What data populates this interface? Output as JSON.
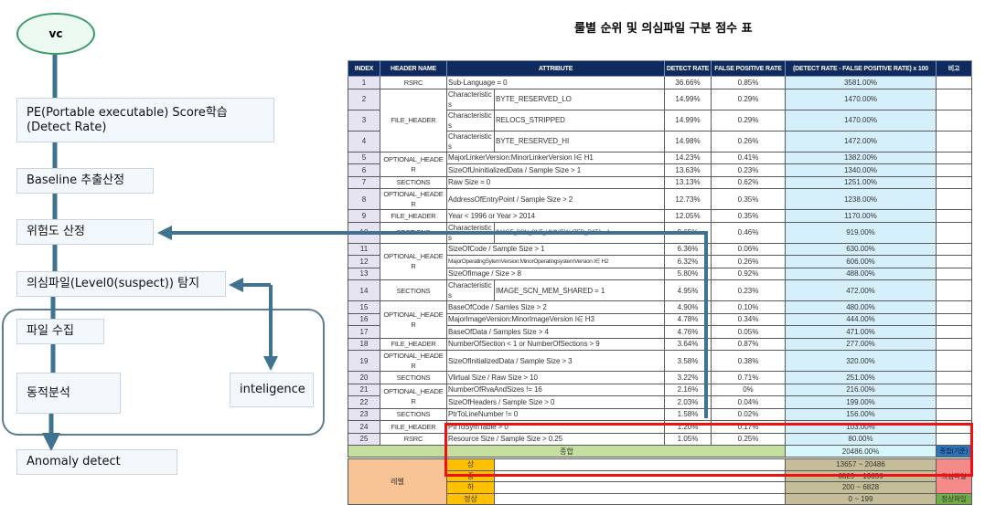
{
  "flow": {
    "start": "vc",
    "steps": [
      "PE(Portable executable) Score학습",
      "(Detect Rate)",
      "Baseline 추출산정",
      "위험도 산정",
      "의심파일(Level0(suspect)) 탐지",
      "파일 수집",
      "동적분석",
      "inteligence",
      "Anomaly detect"
    ]
  },
  "table": {
    "title": "룰별 순위 및 의심파일 구분 점수 표",
    "headers": [
      "INDEX",
      "HEADER NAME",
      "ATTRIBUTE",
      "DETECT RATE",
      "FALSE POSITIVE RATE",
      "(DETECT RATE - FALSE POSITIVE RATE) x 100",
      "비고"
    ],
    "groups": [
      {
        "name": "RSRC",
        "span": 1
      },
      {
        "name": "FILE_HEADER",
        "span": 3
      },
      {
        "name": "OPTIONAL_HEADER",
        "span": 2
      },
      {
        "name": "SECTIONS",
        "span": 1
      },
      {
        "name": "OPTIONAL_HEADER",
        "span": 1
      },
      {
        "name": "FILE_HEADER",
        "span": 1
      },
      {
        "name": "SECTIONS",
        "span": 1
      },
      {
        "name": "OPTIONAL_HEADER",
        "span": 3
      },
      {
        "name": "SECTIONS",
        "span": 1
      },
      {
        "name": "OPTIONAL_HEADER",
        "span": 3
      },
      {
        "name": "FILE_HEADER",
        "span": 1
      },
      {
        "name": "OPTIONAL_HEADER",
        "span": 1
      },
      {
        "name": "SECTIONS",
        "span": 1
      },
      {
        "name": "OPTIONAL_HEADER",
        "span": 2
      },
      {
        "name": "SECTIONS",
        "span": 1
      },
      {
        "name": "FILE_HEADER",
        "span": 1
      },
      {
        "name": "RSRC",
        "span": 1
      }
    ],
    "rows": [
      {
        "index": "1",
        "attr": [
          "Sub-Language = 0"
        ],
        "dr": "36.66%",
        "fpr": "0.85%",
        "score": "3581.00%"
      },
      {
        "index": "2",
        "attr": [
          "Characteristics",
          "BYTE_RESERVED_LO"
        ],
        "dr": "14.99%",
        "fpr": "0.29%",
        "score": "1470.00%"
      },
      {
        "index": "3",
        "attr": [
          "Characteristics",
          "RELOCS_STRIPPED"
        ],
        "dr": "14.99%",
        "fpr": "0.29%",
        "score": "1470.00%"
      },
      {
        "index": "4",
        "attr": [
          "Characteristics",
          "BYTE_RESERVED_HI"
        ],
        "dr": "14.98%",
        "fpr": "0.26%",
        "score": "1472.00%"
      },
      {
        "index": "5",
        "attr": [
          "MajorLinkerVersion:MinorLinkerVersion I∈ H1"
        ],
        "dr": "14.23%",
        "fpr": "0.41%",
        "score": "1382.00%"
      },
      {
        "index": "6",
        "attr": [
          "SizeOfUninitializedData / Sample Size > 1"
        ],
        "dr": "13.63%",
        "fpr": "0.23%",
        "score": "1340.00%"
      },
      {
        "index": "7",
        "attr": [
          "Raw Size = 0"
        ],
        "dr": "13.13%",
        "fpr": "0.62%",
        "score": "1251.00%"
      },
      {
        "index": "8",
        "attr": [
          "AddressOfEntryPoint / Sample Size > 2"
        ],
        "dr": "12.73%",
        "fpr": "0.35%",
        "score": "1238.00%"
      },
      {
        "index": "9",
        "attr": [
          "Year < 1996 or Year > 2014"
        ],
        "dr": "12.05%",
        "fpr": "0.35%",
        "score": "1170.00%"
      },
      {
        "index": "10",
        "attr": [
          "Characteristics",
          "IMAGE_SCN_CNT_UNINITIALIZED_DATA = 1"
        ],
        "dr": "9.65%",
        "fpr": "0.46%",
        "score": "919.00%"
      },
      {
        "index": "11",
        "attr": [
          "SizeOfCode / Sample Size > 1"
        ],
        "dr": "6.36%",
        "fpr": "0.06%",
        "score": "630.00%"
      },
      {
        "index": "12",
        "attr": [
          "MajorOperatingSytemVersion:MinorOperatingsystemVersion I∈ H2"
        ],
        "dr": "6.32%",
        "fpr": "0.26%",
        "score": "606.00%"
      },
      {
        "index": "13",
        "attr": [
          "SizeOfImage / Size > 8"
        ],
        "dr": "5.80%",
        "fpr": "0.92%",
        "score": "488.00%"
      },
      {
        "index": "14",
        "attr": [
          "Characteristics",
          "IMAGE_SCN_MEM_SHARED = 1"
        ],
        "dr": "4.95%",
        "fpr": "0.23%",
        "score": "472.00%"
      },
      {
        "index": "15",
        "attr": [
          "BaseOfCode / Samles Size > 2"
        ],
        "dr": "4.90%",
        "fpr": "0.10%",
        "score": "480.00%"
      },
      {
        "index": "16",
        "attr": [
          "MajorImageVersion:MinorImageVersion I∈ H3"
        ],
        "dr": "4.78%",
        "fpr": "0.34%",
        "score": "444.00%"
      },
      {
        "index": "17",
        "attr": [
          "BaseOfData / Samples Size > 4"
        ],
        "dr": "4.76%",
        "fpr": "0.05%",
        "score": "471.00%"
      },
      {
        "index": "18",
        "attr": [
          "NumberOfSection < 1 or NumberOfSections > 9"
        ],
        "dr": "3.64%",
        "fpr": "0.87%",
        "score": "277.00%"
      },
      {
        "index": "19",
        "attr": [
          "SizeOfInitializedData / Sample Size > 3"
        ],
        "dr": "3.58%",
        "fpr": "0.38%",
        "score": "320.00%"
      },
      {
        "index": "20",
        "attr": [
          "Vlirtual Size / Raw Size > 10"
        ],
        "dr": "3.22%",
        "fpr": "0.71%",
        "score": "251.00%"
      },
      {
        "index": "21",
        "attr": [
          "NumberOfRvaAndSizes != 16"
        ],
        "dr": "2.16%",
        "fpr": "0%",
        "score": "216.00%"
      },
      {
        "index": "22",
        "attr": [
          "SizeOfHeaders / Sample Size > 0"
        ],
        "dr": "2.03%",
        "fpr": "0.04%",
        "score": "199.00%"
      },
      {
        "index": "23",
        "attr": [
          "PtrToLineNumber != 0"
        ],
        "dr": "1.58%",
        "fpr": "0.02%",
        "score": "156.00%"
      },
      {
        "index": "24",
        "attr": [
          "PtrToSymTable > 0"
        ],
        "dr": "1.20%",
        "fpr": "0.17%",
        "score": "103.00%"
      },
      {
        "index": "25",
        "attr": [
          "Resource Size / Sample Size > 0.25"
        ],
        "dr": "1.05%",
        "fpr": "0.25%",
        "score": "80.00%"
      }
    ],
    "total": {
      "label": "종합",
      "score": "20486.00%",
      "note": "종합(기준)"
    },
    "levels": {
      "label": "레벨",
      "rows": [
        {
          "level": "상",
          "range": "13657 ~ 20486"
        },
        {
          "level": "중",
          "range": "6829 ~ 13656"
        },
        {
          "level": "하",
          "range": "200 ~ 6828"
        },
        {
          "level": "정상",
          "range": "0 ~ 199"
        }
      ],
      "suspect_label": "의심파일",
      "normal_label": "정상파일"
    }
  },
  "colors": {
    "header_bg": "#0f2a5c",
    "score_bg": "#d6f0fb",
    "total_bg": "#c4dfa0",
    "arrow": "#3f7391",
    "highlight": "#ee1111"
  }
}
